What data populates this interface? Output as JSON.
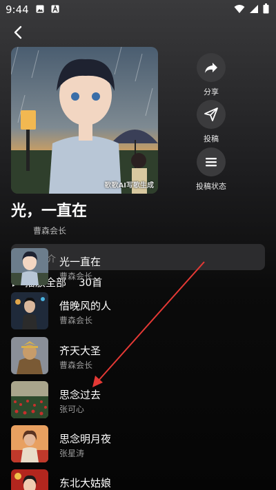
{
  "status_bar": {
    "time": "9:44",
    "icons": [
      "image-icon",
      "a-icon",
      "wifi-icon",
      "signal-icon",
      "battery-icon"
    ]
  },
  "header": {
    "back_icon": "chevron-left-icon"
  },
  "cover": {
    "watermark": "歌歌AI写歌生成"
  },
  "actions": [
    {
      "label": "分享",
      "icon": "share-icon"
    },
    {
      "label": "投稿",
      "icon": "send-icon"
    },
    {
      "label": "投稿状态",
      "icon": "menu-icon"
    }
  ],
  "playlist": {
    "title": "光，一直在",
    "author": "曹森会长",
    "intro_label": "介",
    "play_all_label": "播放全部",
    "count": "30首"
  },
  "songs": [
    {
      "title": "光一直在",
      "artist": "曹森会长",
      "thumb": "anime-boy-rain"
    },
    {
      "title": "借晚风的人",
      "artist": "曹森会长",
      "thumb": "man-night-street"
    },
    {
      "title": "齐天大圣",
      "artist": "曹森会长",
      "thumb": "monkey-king"
    },
    {
      "title": "思念过去",
      "artist": "张可心",
      "thumb": "red-flower-field"
    },
    {
      "title": "思念明月夜",
      "artist": "张星涛",
      "thumb": "girl-car-sunset"
    },
    {
      "title": "东北大姑娘",
      "artist": "",
      "thumb": "girl-red-festival"
    }
  ],
  "colors": {
    "annotation_arrow": "#e53935",
    "action_bg": "#3b3b3d",
    "intro_bg": "#2c2c2e"
  }
}
